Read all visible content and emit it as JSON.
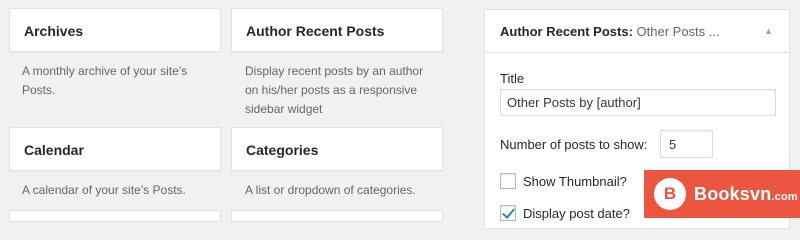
{
  "widgets": [
    {
      "title": "Archives",
      "desc": "A monthly archive of your site’s Posts."
    },
    {
      "title": "Author Recent Posts",
      "desc": "Display recent posts by an author on his/her posts as a responsive sidebar widget"
    },
    {
      "title": "Calendar",
      "desc": "A calendar of your site’s Posts."
    },
    {
      "title": "Categories",
      "desc": "A list or dropdown of categories."
    }
  ],
  "panel": {
    "title": "Author Recent Posts:",
    "subtitle": "Other Posts ...",
    "title_label": "Title",
    "title_value": "Other Posts by [author]",
    "num_label": "Number of posts to show:",
    "num_value": "5",
    "show_thumbnail_label": "Show Thumbnail?",
    "show_thumbnail_checked": false,
    "display_date_label": "Display post date?",
    "display_date_checked": true
  },
  "watermark": {
    "brand": "Booksvn",
    "domain": ".com"
  }
}
